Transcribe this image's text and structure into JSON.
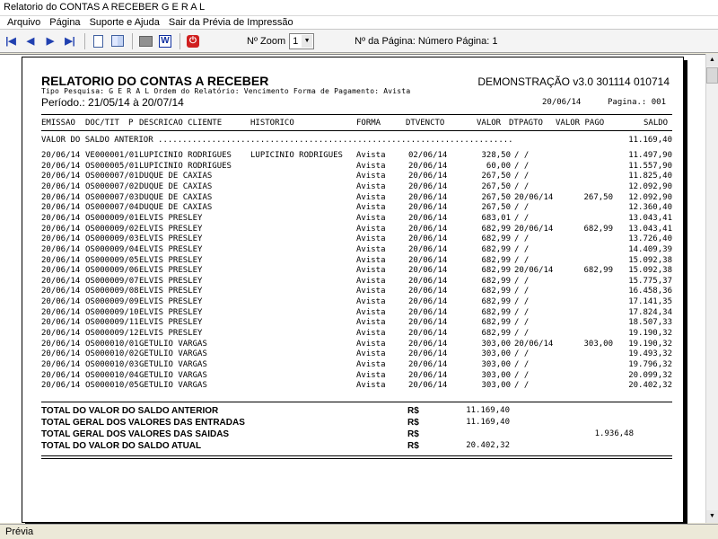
{
  "window": {
    "title": "Relatorio do CONTAS A RECEBER G E R A L"
  },
  "menu": [
    "Arquivo",
    "Página",
    "Suporte e Ajuda",
    "Sair da Prévia de Impressão"
  ],
  "toolbar": {
    "zoom_label": "Nº Zoom",
    "zoom_value": "1",
    "page_label": "Nº da Página: Número Página: 1",
    "icons": [
      "first-page-icon",
      "prev-page-icon",
      "next-page-icon",
      "last-page-icon",
      "single-page-icon",
      "two-pages-icon",
      "printer-icon",
      "word-export-icon",
      "power-exit-icon"
    ]
  },
  "status": {
    "text": "Prévia"
  },
  "report": {
    "title": "RELATORIO DO CONTAS A RECEBER",
    "demo": "DEMONSTRAÇÃO v3.0 301114 010714",
    "subtitle": "Tipo Pesquisa: G E R A L   Ordem do Relatório: Vencimento   Forma de Pagamento: Avista",
    "periodo": "Período.: 21/05/14 à 20/07/14",
    "date": "20/06/14",
    "pagina": "Pagina.: 001",
    "columns": {
      "emissao": "EMISSAO",
      "doc": "DOC/TIT",
      "p": "P",
      "cliente": "DESCRICAO CLIENTE",
      "historico": "HISTORICO",
      "forma": "FORMA",
      "dtvencto": "DTVENCTO",
      "valor": "VALOR",
      "dtpagto": "DTPAGTO",
      "valor_pago": "VALOR PAGO",
      "saldo": "SALDO"
    },
    "saldo_anterior_label": "VALOR DO SALDO ANTERIOR .........................................................................",
    "saldo_anterior_value": "11.169,40",
    "rows": [
      {
        "emissao": "20/06/14",
        "doc": "VE000001/01",
        "cliente": "LUPICINIO RODRIGUES",
        "historico": "LUPICINIO RODRIGUES",
        "forma": "Avista",
        "venc": "02/06/14",
        "valor": "328,50",
        "dtpagto": "/ /",
        "pago": "",
        "saldo": "11.497,90"
      },
      {
        "emissao": "20/06/14",
        "doc": "OS000005/01",
        "cliente": "LUPICINIO RODRIGUES",
        "historico": "",
        "forma": "Avista",
        "venc": "20/06/14",
        "valor": "60,00",
        "dtpagto": "/ /",
        "pago": "",
        "saldo": "11.557,90"
      },
      {
        "emissao": "20/06/14",
        "doc": "OS000007/01",
        "cliente": "DUQUE DE CAXIAS",
        "historico": "",
        "forma": "Avista",
        "venc": "20/06/14",
        "valor": "267,50",
        "dtpagto": "/ /",
        "pago": "",
        "saldo": "11.825,40"
      },
      {
        "emissao": "20/06/14",
        "doc": "OS000007/02",
        "cliente": "DUQUE DE CAXIAS",
        "historico": "",
        "forma": "Avista",
        "venc": "20/06/14",
        "valor": "267,50",
        "dtpagto": "/ /",
        "pago": "",
        "saldo": "12.092,90"
      },
      {
        "emissao": "20/06/14",
        "doc": "OS000007/03",
        "cliente": "DUQUE DE CAXIAS",
        "historico": "",
        "forma": "Avista",
        "venc": "20/06/14",
        "valor": "267,50",
        "dtpagto": "20/06/14",
        "pago": "267,50",
        "saldo": "12.092,90"
      },
      {
        "emissao": "20/06/14",
        "doc": "OS000007/04",
        "cliente": "DUQUE DE CAXIAS",
        "historico": "",
        "forma": "Avista",
        "venc": "20/06/14",
        "valor": "267,50",
        "dtpagto": "/ /",
        "pago": "",
        "saldo": "12.360,40"
      },
      {
        "emissao": "20/06/14",
        "doc": "OS000009/01",
        "cliente": "ELVIS PRESLEY",
        "historico": "",
        "forma": "Avista",
        "venc": "20/06/14",
        "valor": "683,01",
        "dtpagto": "/ /",
        "pago": "",
        "saldo": "13.043,41"
      },
      {
        "emissao": "20/06/14",
        "doc": "OS000009/02",
        "cliente": "ELVIS PRESLEY",
        "historico": "",
        "forma": "Avista",
        "venc": "20/06/14",
        "valor": "682,99",
        "dtpagto": "20/06/14",
        "pago": "682,99",
        "saldo": "13.043,41"
      },
      {
        "emissao": "20/06/14",
        "doc": "OS000009/03",
        "cliente": "ELVIS PRESLEY",
        "historico": "",
        "forma": "Avista",
        "venc": "20/06/14",
        "valor": "682,99",
        "dtpagto": "/ /",
        "pago": "",
        "saldo": "13.726,40"
      },
      {
        "emissao": "20/06/14",
        "doc": "OS000009/04",
        "cliente": "ELVIS PRESLEY",
        "historico": "",
        "forma": "Avista",
        "venc": "20/06/14",
        "valor": "682,99",
        "dtpagto": "/ /",
        "pago": "",
        "saldo": "14.409,39"
      },
      {
        "emissao": "20/06/14",
        "doc": "OS000009/05",
        "cliente": "ELVIS PRESLEY",
        "historico": "",
        "forma": "Avista",
        "venc": "20/06/14",
        "valor": "682,99",
        "dtpagto": "/ /",
        "pago": "",
        "saldo": "15.092,38"
      },
      {
        "emissao": "20/06/14",
        "doc": "OS000009/06",
        "cliente": "ELVIS PRESLEY",
        "historico": "",
        "forma": "Avista",
        "venc": "20/06/14",
        "valor": "682,99",
        "dtpagto": "20/06/14",
        "pago": "682,99",
        "saldo": "15.092,38"
      },
      {
        "emissao": "20/06/14",
        "doc": "OS000009/07",
        "cliente": "ELVIS PRESLEY",
        "historico": "",
        "forma": "Avista",
        "venc": "20/06/14",
        "valor": "682,99",
        "dtpagto": "/ /",
        "pago": "",
        "saldo": "15.775,37"
      },
      {
        "emissao": "20/06/14",
        "doc": "OS000009/08",
        "cliente": "ELVIS PRESLEY",
        "historico": "",
        "forma": "Avista",
        "venc": "20/06/14",
        "valor": "682,99",
        "dtpagto": "/ /",
        "pago": "",
        "saldo": "16.458,36"
      },
      {
        "emissao": "20/06/14",
        "doc": "OS000009/09",
        "cliente": "ELVIS PRESLEY",
        "historico": "",
        "forma": "Avista",
        "venc": "20/06/14",
        "valor": "682,99",
        "dtpagto": "/ /",
        "pago": "",
        "saldo": "17.141,35"
      },
      {
        "emissao": "20/06/14",
        "doc": "OS000009/10",
        "cliente": "ELVIS PRESLEY",
        "historico": "",
        "forma": "Avista",
        "venc": "20/06/14",
        "valor": "682,99",
        "dtpagto": "/ /",
        "pago": "",
        "saldo": "17.824,34"
      },
      {
        "emissao": "20/06/14",
        "doc": "OS000009/11",
        "cliente": "ELVIS PRESLEY",
        "historico": "",
        "forma": "Avista",
        "venc": "20/06/14",
        "valor": "682,99",
        "dtpagto": "/ /",
        "pago": "",
        "saldo": "18.507,33"
      },
      {
        "emissao": "20/06/14",
        "doc": "OS000009/12",
        "cliente": "ELVIS PRESLEY",
        "historico": "",
        "forma": "Avista",
        "venc": "20/06/14",
        "valor": "682,99",
        "dtpagto": "/ /",
        "pago": "",
        "saldo": "19.190,32"
      },
      {
        "emissao": "20/06/14",
        "doc": "OS000010/01",
        "cliente": "GETULIO VARGAS",
        "historico": "",
        "forma": "Avista",
        "venc": "20/06/14",
        "valor": "303,00",
        "dtpagto": "20/06/14",
        "pago": "303,00",
        "saldo": "19.190,32"
      },
      {
        "emissao": "20/06/14",
        "doc": "OS000010/02",
        "cliente": "GETULIO VARGAS",
        "historico": "",
        "forma": "Avista",
        "venc": "20/06/14",
        "valor": "303,00",
        "dtpagto": "/ /",
        "pago": "",
        "saldo": "19.493,32"
      },
      {
        "emissao": "20/06/14",
        "doc": "OS000010/03",
        "cliente": "GETULIO VARGAS",
        "historico": "",
        "forma": "Avista",
        "venc": "20/06/14",
        "valor": "303,00",
        "dtpagto": "/ /",
        "pago": "",
        "saldo": "19.796,32"
      },
      {
        "emissao": "20/06/14",
        "doc": "OS000010/04",
        "cliente": "GETULIO VARGAS",
        "historico": "",
        "forma": "Avista",
        "venc": "20/06/14",
        "valor": "303,00",
        "dtpagto": "/ /",
        "pago": "",
        "saldo": "20.099,32"
      },
      {
        "emissao": "20/06/14",
        "doc": "OS000010/05",
        "cliente": "GETULIO VARGAS",
        "historico": "",
        "forma": "Avista",
        "venc": "20/06/14",
        "valor": "303,00",
        "dtpagto": "/ /",
        "pago": "",
        "saldo": "20.402,32"
      }
    ],
    "totals": [
      {
        "label": "TOTAL DO VALOR DO SALDO ANTERIOR",
        "currency": "R$",
        "valor": "11.169,40",
        "saidas": ""
      },
      {
        "label": "TOTAL GERAL DOS VALORES DAS ENTRADAS",
        "currency": "R$",
        "valor": "11.169,40",
        "saidas": ""
      },
      {
        "label": "TOTAL GERAL DOS VALORES DAS SAIDAS",
        "currency": "R$",
        "valor": "",
        "saidas": "1.936,48"
      },
      {
        "label": "TOTAL DO VALOR DO SALDO ATUAL",
        "currency": "R$",
        "valor": "20.402,32",
        "saidas": ""
      }
    ]
  }
}
